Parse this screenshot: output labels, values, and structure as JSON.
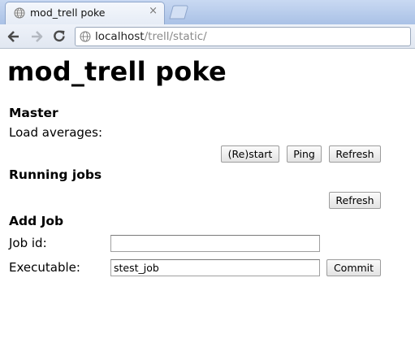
{
  "browser": {
    "tab_title": "mod_trell poke",
    "tab_close": "×",
    "url_host": "localhost",
    "url_path": "/trell/static/"
  },
  "page": {
    "title": "mod_trell poke",
    "master": {
      "heading": "Master",
      "load_label": "Load averages:",
      "restart_label": "(Re)start",
      "ping_label": "Ping",
      "refresh_label": "Refresh"
    },
    "running": {
      "heading": "Running jobs",
      "refresh_label": "Refresh"
    },
    "add_job": {
      "heading": "Add Job",
      "job_id_label": "Job id:",
      "job_id_value": "",
      "executable_label": "Executable:",
      "executable_value": "stest_job",
      "commit_label": "Commit"
    }
  },
  "colors": {
    "tabbar": "#b6cbeb",
    "path_gray": "#8a8a8a"
  }
}
